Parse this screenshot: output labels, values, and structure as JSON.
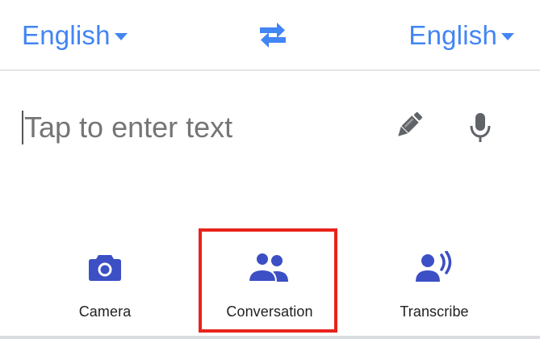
{
  "languages": {
    "source": "English",
    "target": "English"
  },
  "input": {
    "placeholder": "Tap to enter text",
    "value": ""
  },
  "modes": [
    {
      "label": "Camera",
      "icon": "camera-icon"
    },
    {
      "label": "Conversation",
      "icon": "people-icon"
    },
    {
      "label": "Transcribe",
      "icon": "transcribe-icon"
    }
  ],
  "colors": {
    "accent": "#4285f4",
    "mode_icon": "#3c4fc4",
    "tool_icon": "#606368",
    "highlight": "#e8231b"
  },
  "icons": {
    "swap": "swap-arrows-icon",
    "handwrite": "pen-icon",
    "voice": "microphone-icon"
  }
}
